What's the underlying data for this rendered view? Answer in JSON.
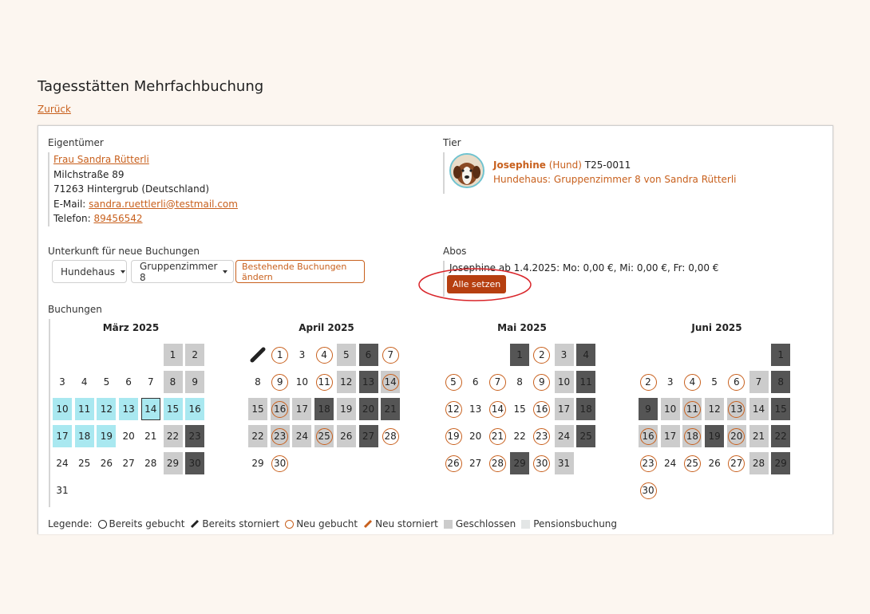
{
  "page": {
    "title": "Tagesstätten Mehrfachbuchung",
    "back_label": "Zurück"
  },
  "owner": {
    "section_label": "Eigentümer",
    "name": "Frau Sandra Rütterli",
    "street": "Milchstraße 89",
    "city": "71263 Hintergrub (Deutschland)",
    "email_prefix": "E-Mail:",
    "email": "sandra.ruettlerli@testmail.com",
    "phone_prefix": "Telefon:",
    "phone": "89456542"
  },
  "animal": {
    "section_label": "Tier",
    "name": "Josephine",
    "species": "(Hund)",
    "id": "T25-0011",
    "housing": "Hundehaus: Gruppenzimmer 8 von Sandra Rütterli",
    "avatar_icon": "dog-photo"
  },
  "accommodation": {
    "section_label": "Unterkunft für neue Buchungen",
    "house": "Hundehaus",
    "room": "Gruppenzimmer 8",
    "change_label": "Bestehende Buchungen ändern"
  },
  "subscriptions": {
    "section_label": "Abos",
    "entry": "Josephine ab 1.4.2025: Mo: 0,00 €, Mi: 0,00 €, Fr: 0,00 €",
    "set_all_label": "Alle setzen",
    "highlight_color": "#d9252a"
  },
  "bookings": {
    "section_label": "Buchungen",
    "months": [
      {
        "title": "März 2025",
        "offset": 5,
        "days": [
          {
            "d": "1",
            "s": "closed"
          },
          {
            "d": "2",
            "s": "closed"
          },
          {
            "d": "3"
          },
          {
            "d": "4"
          },
          {
            "d": "5"
          },
          {
            "d": "6"
          },
          {
            "d": "7"
          },
          {
            "d": "8",
            "s": "closed"
          },
          {
            "d": "9",
            "s": "closed"
          },
          {
            "d": "10",
            "s": "blue"
          },
          {
            "d": "11",
            "s": "blue"
          },
          {
            "d": "12",
            "s": "blue"
          },
          {
            "d": "13",
            "s": "blue"
          },
          {
            "d": "14",
            "s": "blue",
            "sel": true
          },
          {
            "d": "15",
            "s": "blue"
          },
          {
            "d": "16",
            "s": "blue"
          },
          {
            "d": "17",
            "s": "blue"
          },
          {
            "d": "18",
            "s": "blue"
          },
          {
            "d": "19",
            "s": "blue"
          },
          {
            "d": "20"
          },
          {
            "d": "21"
          },
          {
            "d": "22",
            "s": "closed"
          },
          {
            "d": "23",
            "s": "dark"
          },
          {
            "d": "24"
          },
          {
            "d": "25"
          },
          {
            "d": "26"
          },
          {
            "d": "27"
          },
          {
            "d": "28"
          },
          {
            "d": "29",
            "s": "closed"
          },
          {
            "d": "30",
            "s": "dark"
          },
          {
            "d": "31"
          }
        ]
      },
      {
        "title": "April 2025",
        "offset": 0,
        "days": [
          {
            "d": "",
            "s": "cancel"
          },
          {
            "d": "1",
            "r": true
          },
          {
            "d": "3"
          },
          {
            "d": "4",
            "r": true
          },
          {
            "d": "5",
            "s": "closed"
          },
          {
            "d": "6",
            "s": "dark"
          },
          {
            "d": "7",
            "r": true
          },
          {
            "d": "8"
          },
          {
            "d": "9",
            "r": true
          },
          {
            "d": "10"
          },
          {
            "d": "11",
            "r": true
          },
          {
            "d": "12",
            "s": "closed"
          },
          {
            "d": "13",
            "s": "dark"
          },
          {
            "d": "14",
            "r": true,
            "s": "closed"
          },
          {
            "d": "15",
            "s": "closed"
          },
          {
            "d": "16",
            "r": true,
            "s": "closed"
          },
          {
            "d": "17",
            "s": "closed"
          },
          {
            "d": "18",
            "s": "dark"
          },
          {
            "d": "19",
            "s": "closed"
          },
          {
            "d": "20",
            "s": "dark"
          },
          {
            "d": "21",
            "s": "dark"
          },
          {
            "d": "22",
            "s": "closed"
          },
          {
            "d": "23",
            "r": true,
            "s": "closed"
          },
          {
            "d": "24",
            "s": "closed"
          },
          {
            "d": "25",
            "r": true,
            "s": "closed"
          },
          {
            "d": "26",
            "s": "closed"
          },
          {
            "d": "27",
            "s": "dark"
          },
          {
            "d": "28",
            "r": true
          },
          {
            "d": "29"
          },
          {
            "d": "30",
            "r": true
          }
        ]
      },
      {
        "title": "Mai 2025",
        "offset": 3,
        "days": [
          {
            "d": "1",
            "s": "dark"
          },
          {
            "d": "2",
            "r": true
          },
          {
            "d": "3",
            "s": "closed"
          },
          {
            "d": "4",
            "s": "dark"
          },
          {
            "d": "5",
            "r": true
          },
          {
            "d": "6"
          },
          {
            "d": "7",
            "r": true
          },
          {
            "d": "8"
          },
          {
            "d": "9",
            "r": true
          },
          {
            "d": "10",
            "s": "closed"
          },
          {
            "d": "11",
            "s": "dark"
          },
          {
            "d": "12",
            "r": true
          },
          {
            "d": "13"
          },
          {
            "d": "14",
            "r": true
          },
          {
            "d": "15"
          },
          {
            "d": "16",
            "r": true
          },
          {
            "d": "17",
            "s": "closed"
          },
          {
            "d": "18",
            "s": "dark"
          },
          {
            "d": "19",
            "r": true
          },
          {
            "d": "20"
          },
          {
            "d": "21",
            "r": true
          },
          {
            "d": "22"
          },
          {
            "d": "23",
            "r": true
          },
          {
            "d": "24",
            "s": "closed"
          },
          {
            "d": "25",
            "s": "dark"
          },
          {
            "d": "26",
            "r": true
          },
          {
            "d": "27"
          },
          {
            "d": "28",
            "r": true
          },
          {
            "d": "29",
            "s": "dark"
          },
          {
            "d": "30",
            "r": true
          },
          {
            "d": "31",
            "s": "closed"
          }
        ]
      },
      {
        "title": "Juni 2025",
        "offset": 6,
        "days": [
          {
            "d": "1",
            "s": "dark"
          },
          {
            "d": "2",
            "r": true
          },
          {
            "d": "3"
          },
          {
            "d": "4",
            "r": true
          },
          {
            "d": "5"
          },
          {
            "d": "6",
            "r": true
          },
          {
            "d": "7",
            "s": "closed"
          },
          {
            "d": "8",
            "s": "dark"
          },
          {
            "d": "9",
            "s": "dark"
          },
          {
            "d": "10",
            "s": "closed"
          },
          {
            "d": "11",
            "r": true,
            "s": "closed"
          },
          {
            "d": "12",
            "s": "closed"
          },
          {
            "d": "13",
            "r": true,
            "s": "closed"
          },
          {
            "d": "14",
            "s": "closed"
          },
          {
            "d": "15",
            "s": "dark"
          },
          {
            "d": "16",
            "r": true,
            "s": "closed"
          },
          {
            "d": "17",
            "s": "closed"
          },
          {
            "d": "18",
            "r": true,
            "s": "closed"
          },
          {
            "d": "19",
            "s": "dark"
          },
          {
            "d": "20",
            "r": true,
            "s": "closed"
          },
          {
            "d": "21",
            "s": "closed"
          },
          {
            "d": "22",
            "s": "dark"
          },
          {
            "d": "23",
            "r": true
          },
          {
            "d": "24"
          },
          {
            "d": "25",
            "r": true
          },
          {
            "d": "26"
          },
          {
            "d": "27",
            "r": true
          },
          {
            "d": "28",
            "s": "closed"
          },
          {
            "d": "29",
            "s": "dark"
          },
          {
            "d": "30",
            "r": true
          }
        ]
      }
    ]
  },
  "legend": {
    "title": "Legende:",
    "booked": "Bereits gebucht",
    "cancelled": "Bereits storniert",
    "new_booked": "Neu gebucht",
    "new_cancelled": "Neu storniert",
    "closed": "Geschlossen",
    "pension": "Pensionsbuchung",
    "closed_color": "#cccccc",
    "pension_color": "#e3e6e6",
    "accent_color": "#c8601d",
    "blue_color": "#a9e8f0",
    "dark_color": "#555555"
  }
}
